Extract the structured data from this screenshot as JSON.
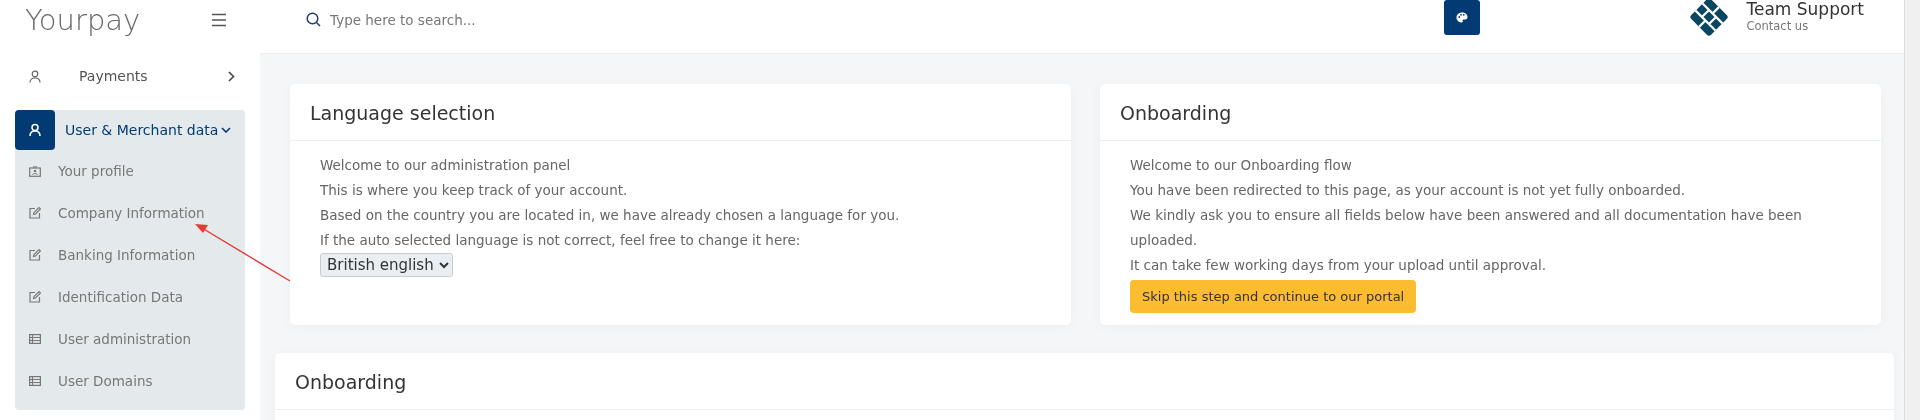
{
  "sidebar": {
    "logo": "Yourpay",
    "items": [
      {
        "label": "Payments",
        "expanded": false
      },
      {
        "label": "User & Merchant data",
        "expanded": true,
        "children": [
          {
            "label": "Your profile",
            "kind": "profile"
          },
          {
            "label": "Company Information",
            "kind": "edit"
          },
          {
            "label": "Banking Information",
            "kind": "edit"
          },
          {
            "label": "Identification Data",
            "kind": "edit"
          },
          {
            "label": "User administration",
            "kind": "list"
          },
          {
            "label": "User Domains",
            "kind": "list"
          }
        ]
      }
    ]
  },
  "topbar": {
    "search": {
      "placeholder": "Type here to search..."
    },
    "support": {
      "title": "Team Support",
      "subtitle": "Contact us"
    }
  },
  "cards": [
    {
      "title": "Language selection",
      "lines": [
        "Welcome to our administration panel",
        "This is where you keep track of your account.",
        "Based on the country you are located in, we have already chosen a language for you.",
        "If the auto selected language is not correct, feel free to change it here:"
      ],
      "kind": "select",
      "control": "British english"
    },
    {
      "title": "Onboarding",
      "lines": [
        "Welcome to our Onboarding flow",
        "You have been redirected to this page, as your account is not yet fully onboarded.",
        "We kindly ask you to ensure all fields below have been answered and all documentation have been uploaded.",
        "It can take few working days from your upload until approval."
      ],
      "kind": "button",
      "control": "Skip this step and continue to our portal"
    }
  ],
  "bottom_card": {
    "title": "Onboarding"
  }
}
